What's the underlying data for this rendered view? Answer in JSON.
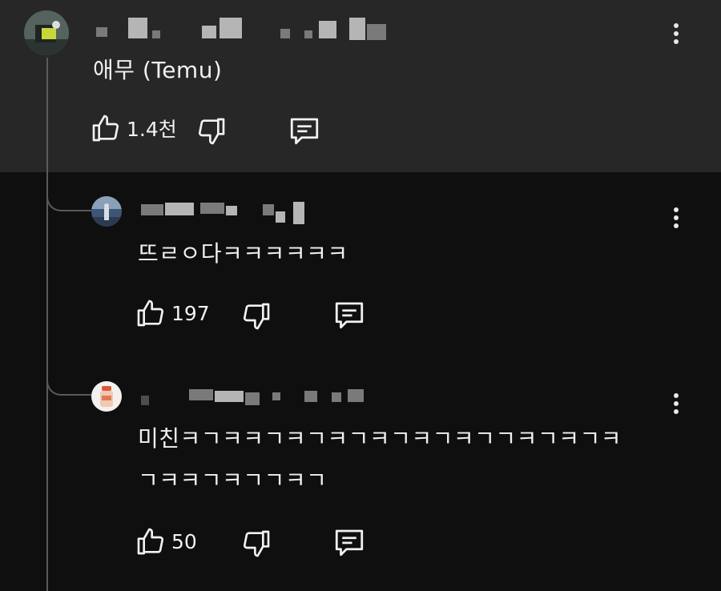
{
  "comments": [
    {
      "text": "애무 (Temu)",
      "likes": "1.4천"
    },
    {
      "text": "뜨ㄹㅇ다ㅋㅋㅋㅋㅋㅋ",
      "likes": "197"
    },
    {
      "text_line1": "미친ㅋㄱㅋㅋㄱㅋㄱㅋㄱㅋㄱㅋㄱㅋㄱㄱㅋㄱㅋㄱㅋ",
      "text_line2": "ㄱㅋㅋㄱㅋㄱㄱㅋㄱ",
      "likes": "50"
    }
  ],
  "icons": [
    "thumbs-up-icon",
    "thumbs-down-icon",
    "reply-icon",
    "more-vert-icon"
  ],
  "colors": {
    "background": "#0f0f0f",
    "highlighted_panel": "#272727",
    "text": "#f1f1f1"
  }
}
